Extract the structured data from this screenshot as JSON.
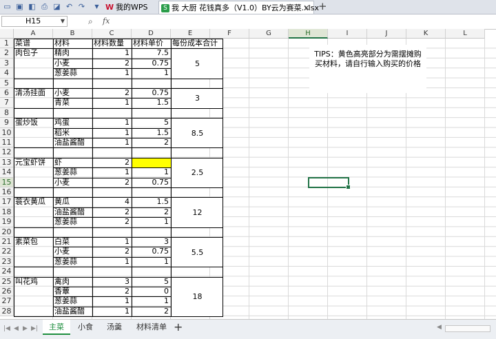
{
  "titlebar": {
    "tabs": [
      {
        "label": "我的WPS",
        "active": false
      },
      {
        "label": "我 大厨 花钱真多（V1.0）BY云为赛菜.xlsx",
        "active": true
      }
    ],
    "close_glyph": "×",
    "new_tab_glyph": "+",
    "accent": "#c8102e"
  },
  "formula_bar": {
    "cell_ref": "H15",
    "fx_label": "fx",
    "formula_value": ""
  },
  "columns": [
    "A",
    "B",
    "C",
    "D",
    "E",
    "F",
    "G",
    "H",
    "I",
    "J",
    "K",
    "L"
  ],
  "rows": [
    "1",
    "2",
    "3",
    "4",
    "5",
    "6",
    "7",
    "8",
    "9",
    "10",
    "11",
    "12",
    "13",
    "14",
    "15",
    "16",
    "17",
    "18",
    "19",
    "20",
    "21",
    "22",
    "23",
    "24",
    "25",
    "26",
    "27",
    "28"
  ],
  "selected": {
    "column": "H",
    "row": "15"
  },
  "header_row": {
    "a": "菜谱",
    "b": "材料",
    "c": "材料数量",
    "d": "材料单价",
    "e": "每份成本合计"
  },
  "cells": {
    "A2": "肉包子",
    "B2": "精肉",
    "C2": "1",
    "D2": "7.5",
    "B3": "小麦",
    "C3": "2",
    "D3": "0.75",
    "B4": "葱姜蒜",
    "C4": "1",
    "D4": "1",
    "A6": "清汤挂面",
    "B6": "小麦",
    "C6": "2",
    "D6": "0.75",
    "B7": "青菜",
    "C7": "1",
    "D7": "1.5",
    "A9": "蛋炒饭",
    "B9": "鸡蛋",
    "C9": "1",
    "D9": "5",
    "B10": "稻米",
    "C10": "1",
    "D10": "1.5",
    "B11": "油盐酱醋",
    "C11": "1",
    "D11": "2",
    "A13": "元宝虾饼",
    "B13": "虾",
    "C13": "2",
    "B14": "葱姜蒜",
    "C14": "1",
    "D14": "1",
    "B15": "小麦",
    "C15": "2",
    "D15": "0.75",
    "A17": "蓑衣黄瓜",
    "B17": "黄瓜",
    "C17": "4",
    "D17": "1.5",
    "B18": "油盐酱醋",
    "C18": "2",
    "D18": "2",
    "B19": "葱姜蒜",
    "C19": "2",
    "D19": "1",
    "A21": "素菜包",
    "B21": "白菜",
    "C21": "1",
    "D21": "3",
    "B22": "小麦",
    "C22": "2",
    "D22": "0.75",
    "B23": "葱姜蒜",
    "C23": "1",
    "D23": "1",
    "A25": "叫花鸡",
    "B25": "禽肉",
    "C25": "3",
    "D25": "5",
    "B26": "香蕈",
    "C26": "2",
    "D26": "0",
    "B27": "葱姜蒜",
    "C27": "1",
    "D27": "1",
    "B28": "油盐酱醋",
    "C28": "1",
    "D28": "2"
  },
  "totals": {
    "E2": "5",
    "E6": "3",
    "E9": "8.5",
    "E13": "2.5",
    "E17": "12",
    "E21": "5.5",
    "E25": "18"
  },
  "highlight_color": "#ffff00",
  "tips": "TIPS：黄色高亮部分为需摆摊购买材料，请自行输入购买的价格",
  "sheets": [
    {
      "label": "主菜",
      "active": true
    },
    {
      "label": "小食",
      "active": false
    },
    {
      "label": "汤羹",
      "active": false
    },
    {
      "label": "材料清单",
      "active": false
    }
  ],
  "add_sheet_glyph": "+"
}
